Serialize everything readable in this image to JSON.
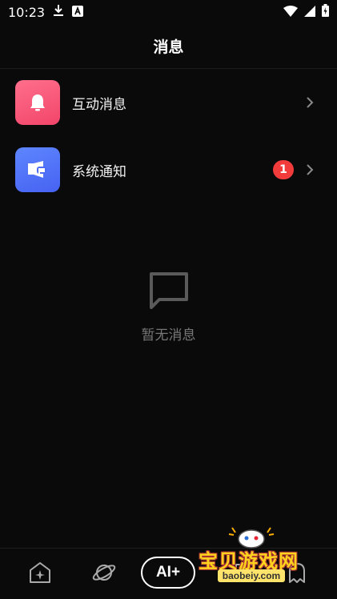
{
  "status_bar": {
    "time": "10:23"
  },
  "header": {
    "title": "消息"
  },
  "messages": [
    {
      "label": "互动消息",
      "icon": "bell-icon",
      "badge": ""
    },
    {
      "label": "系统通知",
      "icon": "megaphone-icon",
      "badge": "1"
    }
  ],
  "empty_state": {
    "text": "暂无消息",
    "icon": "chat-bubble-icon"
  },
  "bottom_nav": {
    "ai_label": "AI+"
  },
  "watermark": {
    "text": "宝贝游戏网",
    "url": "baobeiy.com"
  },
  "colors": {
    "background": "#0a0a0a",
    "badge": "#f23c3c",
    "pink_icon": "#f2456a",
    "blue_icon": "#4662f2"
  }
}
